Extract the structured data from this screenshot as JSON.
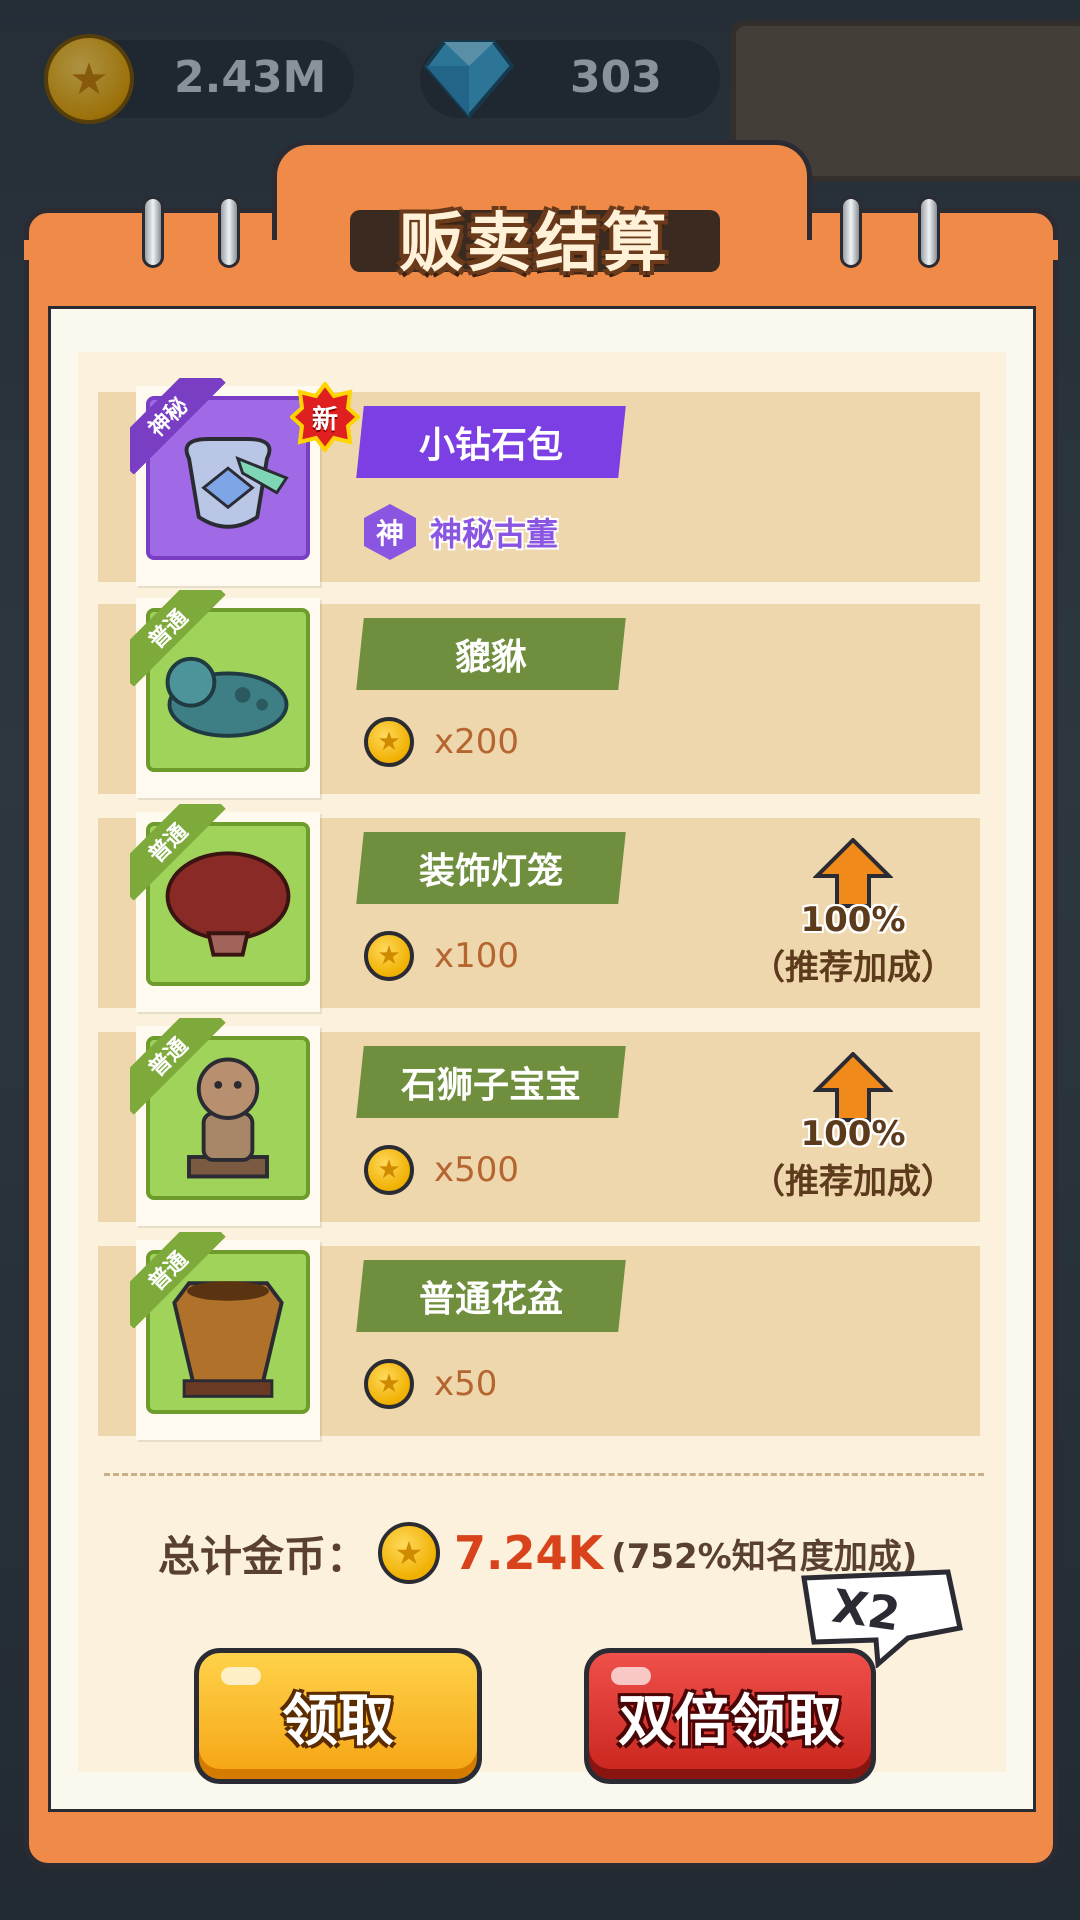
{
  "currency": {
    "gold": "2.43M",
    "gems": "303"
  },
  "dialog": {
    "title": "贩卖结算",
    "items": [
      {
        "name": "小钻石包",
        "tag": "神秘",
        "new_badge": "新",
        "rarity_icon": "神",
        "rarity_text": "神秘古董",
        "type": "mystic"
      },
      {
        "name": "貔貅",
        "tag": "普通",
        "price": "x200",
        "type": "common"
      },
      {
        "name": "装饰灯笼",
        "tag": "普通",
        "price": "x100",
        "bonus_pct": "100%",
        "bonus_label": "（推荐加成）",
        "type": "common"
      },
      {
        "name": "石狮子宝宝",
        "tag": "普通",
        "price": "x500",
        "bonus_pct": "100%",
        "bonus_label": "（推荐加成）",
        "type": "common"
      },
      {
        "name": "普通花盆",
        "tag": "普通",
        "price": "x50",
        "type": "common"
      }
    ],
    "total_label": "总计金币：",
    "total_value": "7.24K",
    "total_bonus": "(752%知名度加成)",
    "x2_badge": "X2",
    "claim_button": "领取",
    "double_claim_button": "双倍领取"
  },
  "icons": {
    "coin": "coin-icon",
    "gem": "gem-icon",
    "bonus": "up-arrow-icon"
  },
  "colors": {
    "dialog_frame": "#f08a48",
    "common_green": "#6f8f3e",
    "mystic_purple": "#7b3fe4",
    "claim_yellow": "#f5a412",
    "double_red": "#c8241e",
    "total_value": "#d8431c"
  }
}
